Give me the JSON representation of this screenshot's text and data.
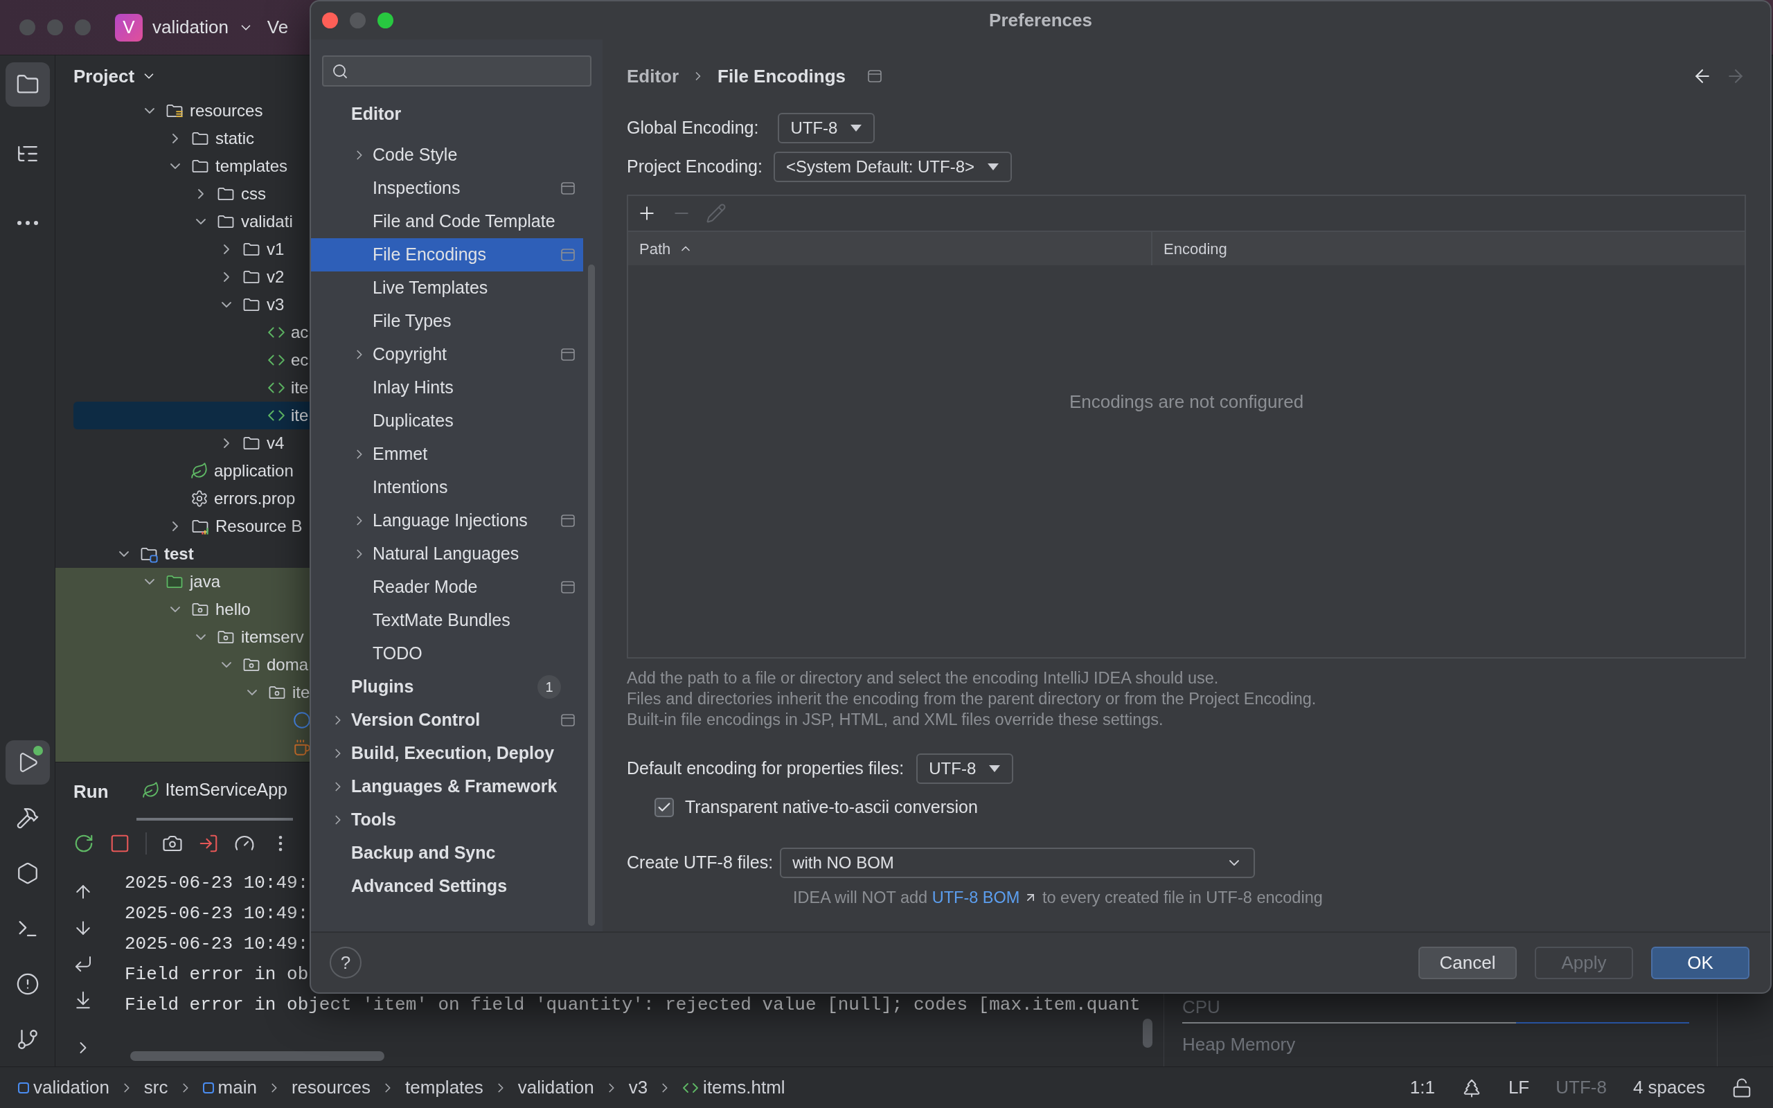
{
  "title_bar": {
    "project_initial": "V",
    "project_name": "validation",
    "next_menu": "Ve"
  },
  "tool_strip": {
    "top": [
      {
        "kind": "project",
        "selected": true
      },
      {
        "kind": "structure",
        "selected": false
      },
      {
        "kind": "more",
        "selected": false
      }
    ],
    "bottom": [
      {
        "kind": "run",
        "selected": true,
        "running": true
      },
      {
        "kind": "build",
        "selected": false
      },
      {
        "kind": "services",
        "selected": false
      },
      {
        "kind": "terminal",
        "selected": false
      },
      {
        "kind": "problems",
        "selected": false
      },
      {
        "kind": "git",
        "selected": false
      }
    ]
  },
  "project_panel": {
    "title": "Project",
    "tree_above": [
      {
        "label": "resources",
        "kind": "resources_folder",
        "expanded": true,
        "selected": false,
        "children": [
          {
            "label": "static",
            "kind": "folder",
            "expanded": false,
            "selected": false
          },
          {
            "label": "templates",
            "kind": "folder",
            "expanded": true,
            "selected": false,
            "children": [
              {
                "label": "css",
                "kind": "folder",
                "expanded": false,
                "selected": false
              },
              {
                "label": "validati",
                "kind": "folder",
                "expanded": true,
                "selected": false,
                "children": [
                  {
                    "label": "v1",
                    "kind": "folder",
                    "expanded": false,
                    "selected": false
                  },
                  {
                    "label": "v2",
                    "kind": "folder",
                    "expanded": false,
                    "selected": false
                  },
                  {
                    "label": "v3",
                    "kind": "folder",
                    "expanded": true,
                    "selected": false,
                    "children": [
                      {
                        "label": "ac",
                        "kind": "html",
                        "selected": false
                      },
                      {
                        "label": "ec",
                        "kind": "html",
                        "selected": false
                      },
                      {
                        "label": "ite",
                        "kind": "html",
                        "selected": false
                      },
                      {
                        "label": "ite",
                        "kind": "html",
                        "selected": true
                      }
                    ]
                  },
                  {
                    "label": "v4",
                    "kind": "folder",
                    "expanded": false,
                    "selected": false
                  }
                ]
              }
            ]
          },
          {
            "label": "application",
            "kind": "spring_config",
            "selected": false
          },
          {
            "label": "errors.prop",
            "kind": "properties",
            "selected": false
          },
          {
            "label": "Resource B",
            "kind": "bundle",
            "expanded": false,
            "selected": false
          }
        ]
      }
    ],
    "tree": [
      {
        "label": "test",
        "kind": "test_root",
        "expanded": true,
        "selected": false,
        "children": [
          {
            "label": "java",
            "kind": "test_sources",
            "expanded": true,
            "selected": false,
            "children": [
              {
                "label": "hello",
                "kind": "package",
                "expanded": true,
                "selected": false,
                "children": [
                  {
                    "label": "itemserv",
                    "kind": "package",
                    "expanded": true,
                    "selected": false,
                    "children": [
                      {
                        "label": "doma",
                        "kind": "package",
                        "expanded": true,
                        "selected": false,
                        "children": [
                          {
                            "label": "ite",
                            "kind": "package",
                            "expanded": true,
                            "selected": false,
                            "children": [
                              {
                                "kind": "class",
                                "selected": false
                              },
                              {
                                "kind": "resource",
                                "selected": false
                              }
                            ]
                          }
                        ]
                      }
                    ]
                  }
                ]
              }
            ]
          }
        ]
      }
    ]
  },
  "run_panel": {
    "title": "Run",
    "tab": "ItemServiceApp",
    "console_lines": [
      "2025-06-23 10:49:",
      "2025-06-23 10:49:",
      "2025-06-23 10:49:",
      "Field error in ob",
      "Field error in object 'item' on field 'quantity': rejected value [null]; codes [max.item.quant"
    ],
    "profiler_labels": [
      "CPU",
      "Heap Memory"
    ]
  },
  "status_bar": {
    "breadcrumb": [
      {
        "label": "validation",
        "kind": "module"
      },
      {
        "label": "src",
        "kind": "folder"
      },
      {
        "label": "main",
        "kind": "module"
      },
      {
        "label": "resources",
        "kind": "folder"
      },
      {
        "label": "templates",
        "kind": "folder"
      },
      {
        "label": "validation",
        "kind": "folder"
      },
      {
        "label": "v3",
        "kind": "folder"
      },
      {
        "label": "items.html",
        "kind": "html"
      }
    ],
    "widgets": [
      {
        "kind": "text",
        "label": "1:1",
        "disabled": false
      },
      {
        "kind": "tree_icon"
      },
      {
        "kind": "text",
        "label": "LF",
        "disabled": false
      },
      {
        "kind": "text",
        "label": "UTF-8",
        "disabled": true
      },
      {
        "kind": "text",
        "label": "4 spaces",
        "disabled": false
      },
      {
        "kind": "lock_icon"
      }
    ]
  },
  "dialog": {
    "title": "Preferences",
    "sidebar": [
      {
        "label": "Editor",
        "selected": false,
        "children": [
          {
            "label": "Code Style",
            "expanded": false,
            "selected": false
          },
          {
            "label": "Inspections",
            "project_scope": true,
            "selected": false
          },
          {
            "label": "File and Code Template",
            "selected": false
          },
          {
            "label": "File Encodings",
            "project_scope": true,
            "selected": true
          },
          {
            "label": "Live Templates",
            "selected": false
          },
          {
            "label": "File Types",
            "selected": false
          },
          {
            "label": "Copyright",
            "expanded": false,
            "project_scope": true,
            "selected": false
          },
          {
            "label": "Inlay Hints",
            "selected": false
          },
          {
            "label": "Duplicates",
            "selected": false
          },
          {
            "label": "Emmet",
            "expanded": false,
            "selected": false
          },
          {
            "label": "Intentions",
            "selected": false
          },
          {
            "label": "Language Injections",
            "expanded": false,
            "project_scope": true,
            "selected": false
          },
          {
            "label": "Natural Languages",
            "expanded": false,
            "selected": false
          },
          {
            "label": "Reader Mode",
            "project_scope": true,
            "selected": false
          },
          {
            "label": "TextMate Bundles",
            "selected": false
          },
          {
            "label": "TODO",
            "selected": false
          }
        ]
      },
      {
        "label": "Plugins",
        "count": "1",
        "selected": false
      },
      {
        "label": "Version Control",
        "expanded": false,
        "project_scope": true,
        "selected": false
      },
      {
        "label": "Build, Execution, Deploy",
        "expanded": false,
        "selected": false
      },
      {
        "label": "Languages & Framework",
        "expanded": false,
        "selected": false
      },
      {
        "label": "Tools",
        "expanded": false,
        "selected": false
      },
      {
        "label": "Backup and Sync",
        "selected": false
      },
      {
        "label": "Advanced Settings",
        "selected": false
      }
    ],
    "breadcrumb": [
      "Editor",
      "File Encodings"
    ],
    "navigation": [
      {
        "kind": "back",
        "disabled": false
      },
      {
        "kind": "forward",
        "disabled": true
      }
    ],
    "global_encoding": {
      "label": "Global Encoding:",
      "value": "UTF-8"
    },
    "project_encoding": {
      "label": "Project Encoding:",
      "value": "<System Default: UTF-8>"
    },
    "mappings_table": {
      "toolbar": [
        {
          "kind": "add",
          "disabled": false
        },
        {
          "kind": "remove",
          "disabled": true
        },
        {
          "kind": "edit",
          "disabled": true
        }
      ],
      "columns": [
        {
          "label": "Path",
          "sorted": true
        },
        {
          "label": "Encoding",
          "sorted": false
        }
      ],
      "empty_text": "Encodings are not configured"
    },
    "description": [
      "Add the path to a file or directory and select the encoding IntelliJ IDEA should use.",
      "Files and directories inherit the encoding from the parent directory or from the Project Encoding.",
      "Built-in file encodings in JSP, HTML, and XML files override these settings."
    ],
    "properties_encoding": {
      "label": "Default encoding for properties files:",
      "value": "UTF-8"
    },
    "native_to_ascii": {
      "label": "Transparent native-to-ascii conversion",
      "checked": true
    },
    "create_utf8": {
      "label": "Create UTF-8 files:",
      "value": "with NO BOM"
    },
    "bom_hint": {
      "before": "IDEA will NOT add",
      "link": "UTF-8 BOM",
      "after": "to every created file in UTF-8 encoding"
    },
    "help_button": "?",
    "buttons": [
      {
        "label": "Cancel",
        "default": false,
        "disabled": false
      },
      {
        "label": "Apply",
        "default": false,
        "disabled": true
      },
      {
        "label": "OK",
        "default": true,
        "disabled": false
      }
    ]
  }
}
